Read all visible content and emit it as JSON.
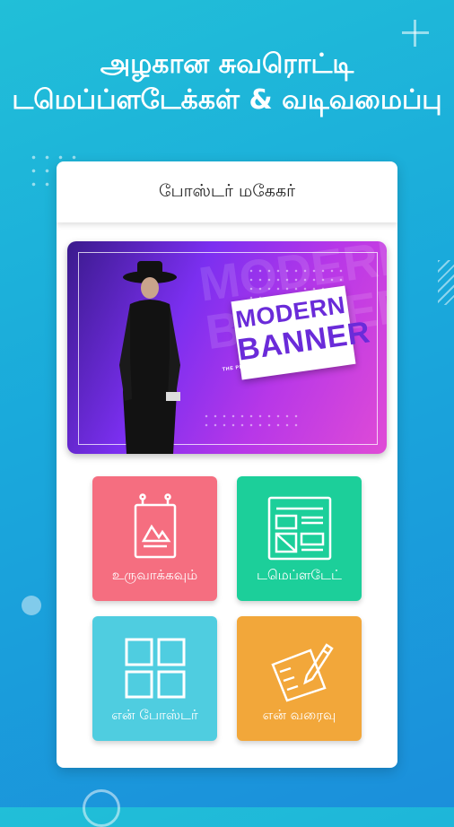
{
  "headline": {
    "line1": "அழகான சுவரொட்டி",
    "line2": "டமெப்ப்ளடேக்கள் & வடிவமைப்பு"
  },
  "card": {
    "title": "பாேஸ்டர் மகேகர்"
  },
  "banner": {
    "line1": "MODERN",
    "line2": "BANNER",
    "tagline": "THE PHOTO OF THE MODEL IS NOT INCLUDED",
    "bg_text": "MODERN BANNER"
  },
  "tiles": [
    {
      "label": "உருவாக்கவும்",
      "icon": "create-poster-icon",
      "color": "#f56e80"
    },
    {
      "label": "டமெப்ளடேட்",
      "icon": "template-icon",
      "color": "#1ccf9a"
    },
    {
      "label": "என் பாேஸ்டர்",
      "icon": "grid-icon",
      "color": "#4fcde0"
    },
    {
      "label": "என் வரைவு",
      "icon": "draft-edit-icon",
      "color": "#f2a73a"
    }
  ]
}
